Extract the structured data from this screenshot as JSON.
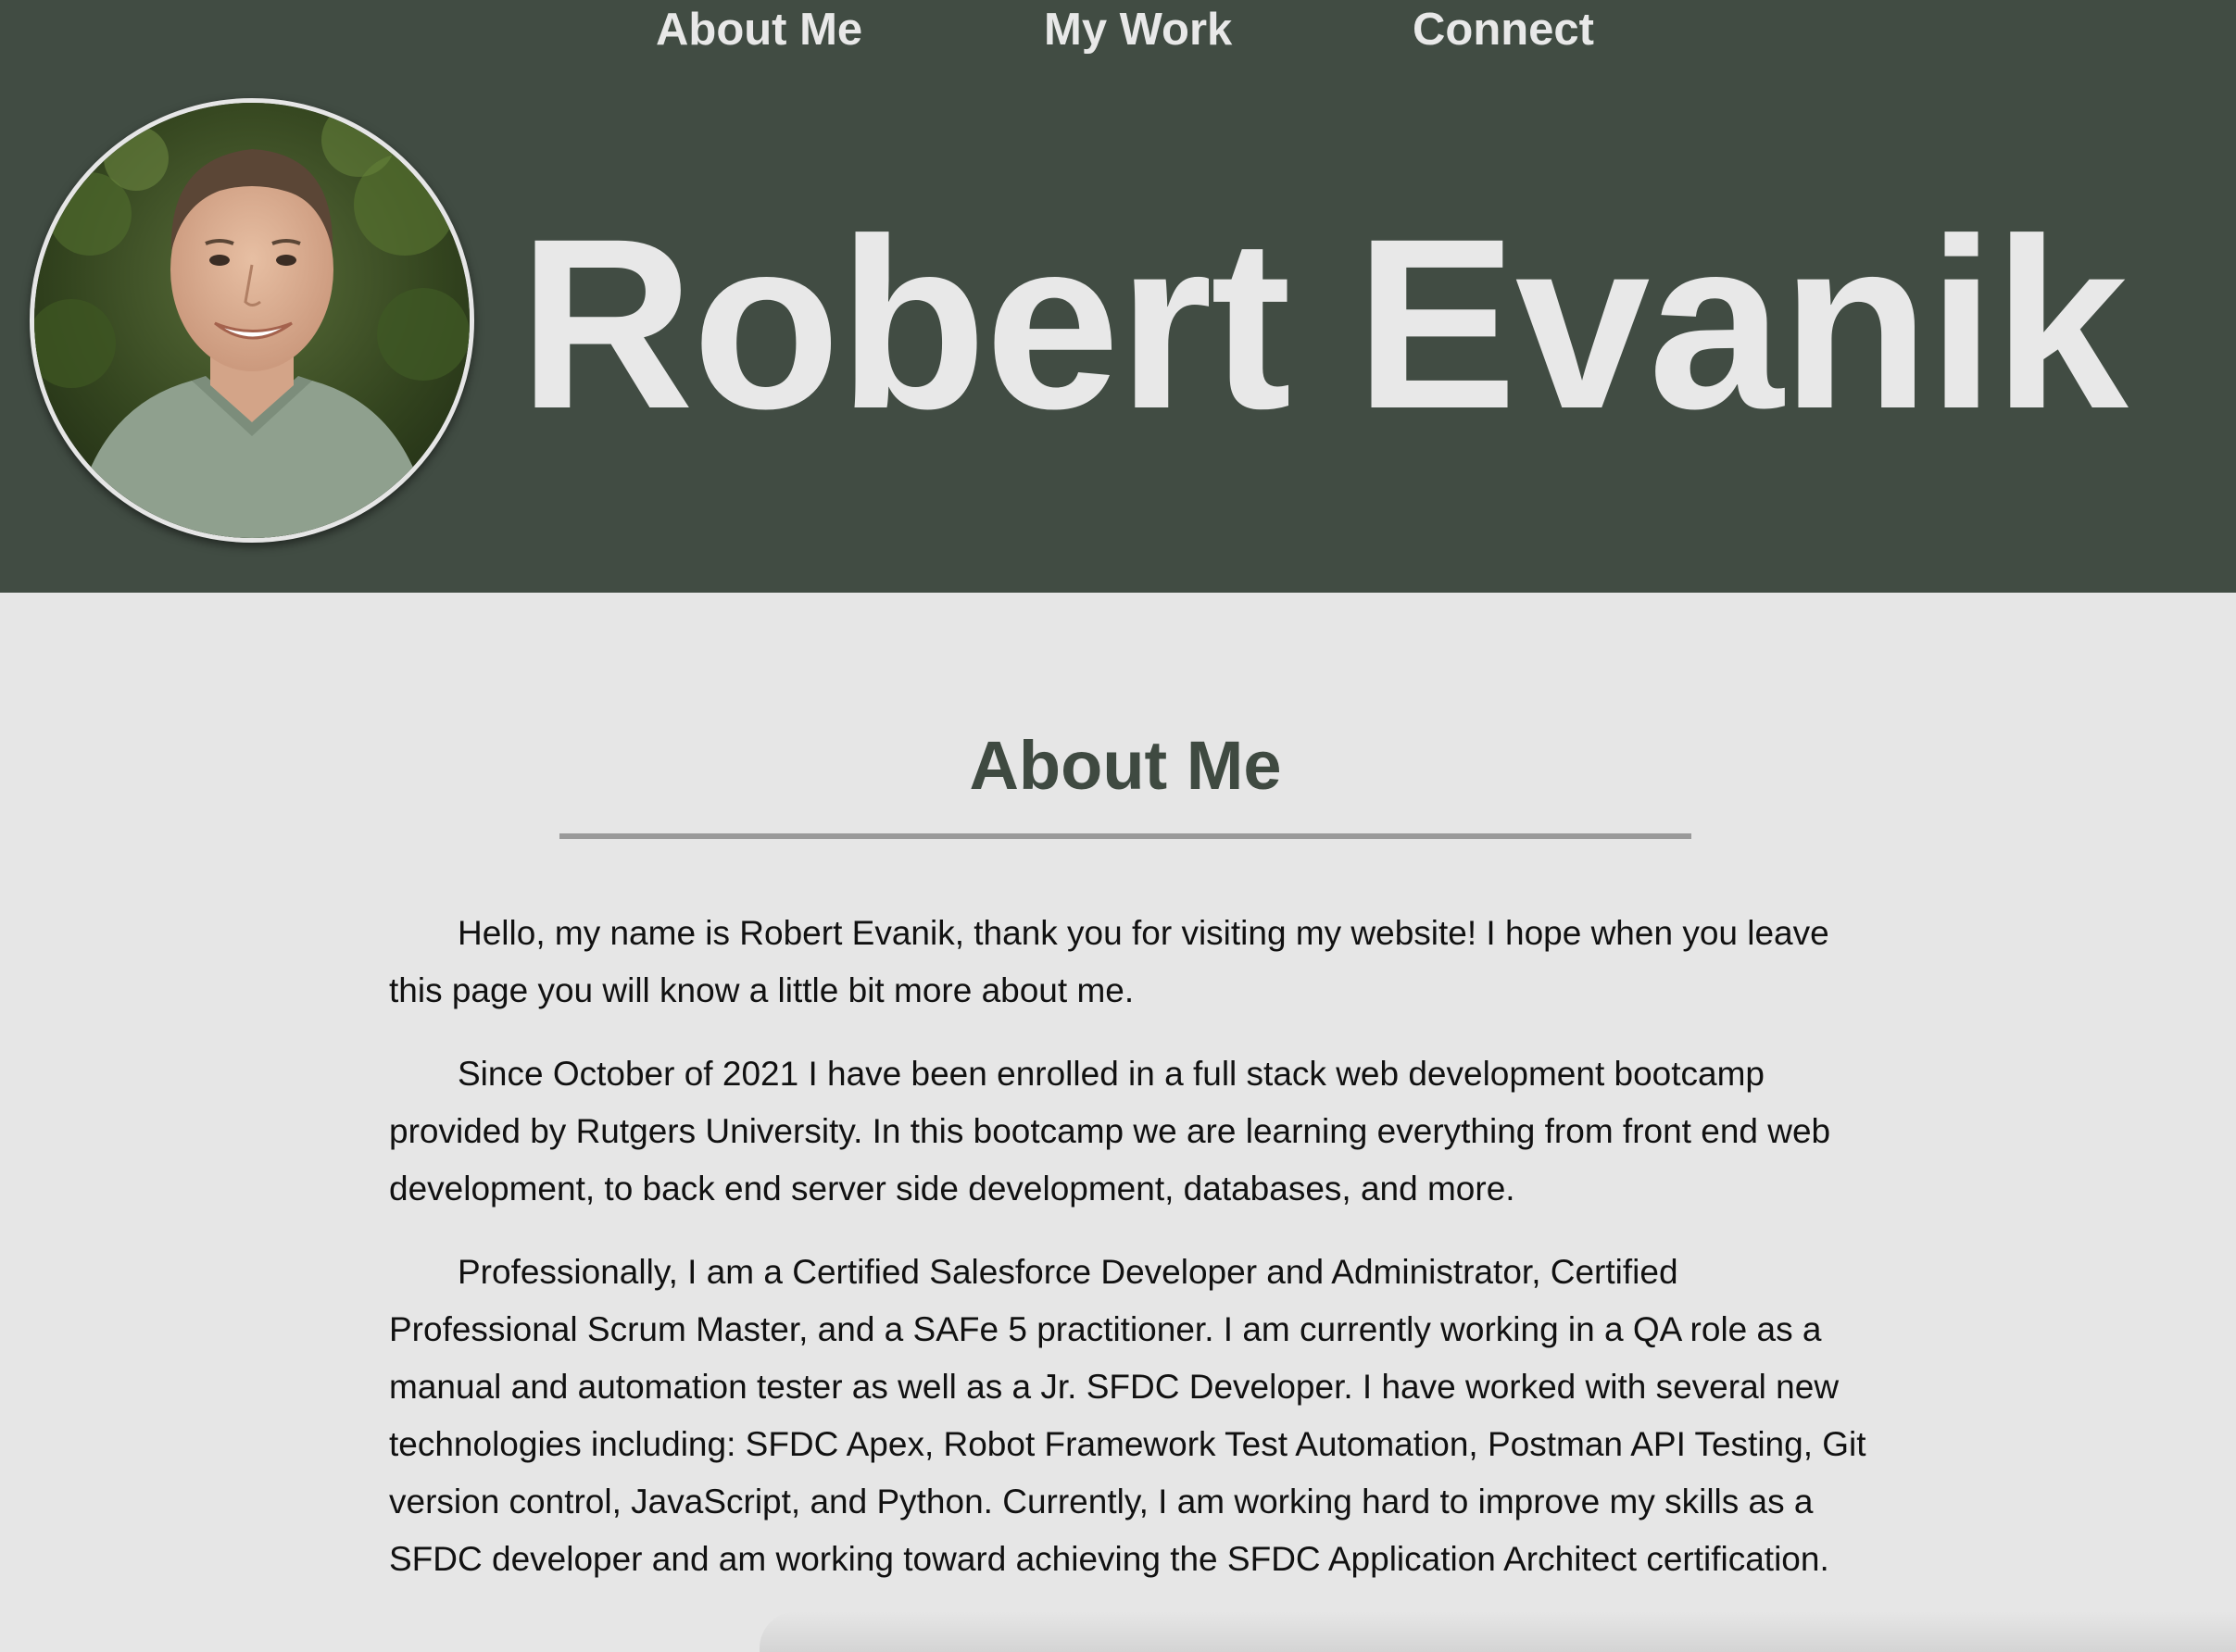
{
  "nav": {
    "about": "About Me",
    "work": "My Work",
    "connect": "Connect"
  },
  "hero": {
    "name": "Robert Evanik",
    "avatar_alt": "profile-photo"
  },
  "about": {
    "title": "About Me",
    "paragraphs": [
      "Hello, my name is Robert Evanik, thank you for visiting my website! I hope when you leave this page you will know a little bit more about me.",
      "Since October of 2021 I have been enrolled in a full stack web development bootcamp provided by Rutgers University. In this bootcamp we are learning everything from front end web development, to back end server side development, databases, and more.",
      "Professionally, I am a Certified Salesforce Developer and Administrator, Certified Professional Scrum Master, and a SAFe 5 practitioner. I am currently working in a QA role as a manual and automation tester as well as a Jr. SFDC Developer. I have worked with several new technologies including: SFDC Apex, Robot Framework Test Automation, Postman API Testing, Git version control, JavaScript, and Python. Currently, I am working hard to improve my skills as a SFDC developer and am working toward achieving the SFDC Application Architect certification."
    ]
  },
  "colors": {
    "header_bg": "#414c43",
    "page_bg": "#e6e6e6",
    "title_color": "#3f4a41",
    "divider": "#9a9a9a"
  }
}
